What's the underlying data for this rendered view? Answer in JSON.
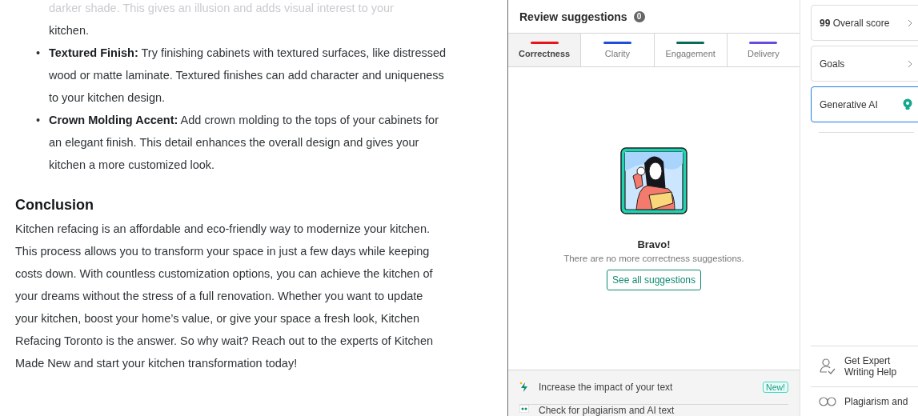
{
  "document": {
    "faded_text": "darker shade. This gives an illusion and adds visual interest to your",
    "bullets": [
      {
        "text": "kitchen."
      },
      {
        "marker": "•",
        "text": "**Textured Finish:** Try finishing cabinets with textured surfaces, like distressed wood or matte laminate. Textured finishes can add character and uniqueness to your kitchen design."
      },
      {
        "marker": "•",
        "text": "**Crown Molding Accent:** Add crown molding to the tops of your cabinets for an elegant finish. This detail enhances the overall design and gives your kitchen a more customized look."
      }
    ],
    "heading": "Conclusion",
    "paragraph": "Kitchen refacing is an affordable and eco-friendly way to modernize your kitchen. This process allows you to transform your space in just a few days while keeping costs down. With countless customization options, you can achieve the kitchen of your dreams without the stress of a full renovation. Whether you want to update your kitchen, boost your home’s value, or give your space a fresh look, Kitchen Refacing Toronto is the answer. So why wait? Reach out to the experts of Kitchen Made New and start your kitchen transformation today!"
  },
  "review": {
    "title": "Review suggestions",
    "count": "0",
    "tabs": [
      {
        "label": "Correctness",
        "color": "#e8141b",
        "selected": true
      },
      {
        "label": "Clarity",
        "color": "#1f4fd8",
        "selected": false
      },
      {
        "label": "Engagement",
        "color": "#0b6b57",
        "selected": false
      },
      {
        "label": "Delivery",
        "color": "#6a4be0",
        "selected": false
      }
    ],
    "empty": {
      "title": "Bravo!",
      "message": "There are no more correctness suggestions.",
      "button": "See all suggestions"
    },
    "footer": [
      {
        "kind": "impact",
        "label": "Increase the impact of your text",
        "badge": "New!"
      },
      {
        "kind": "plagiarism",
        "label": "Check for plagiarism and AI text"
      }
    ]
  },
  "sidebar": {
    "cards": [
      {
        "kind": "score",
        "score": "99",
        "label": "Overall score",
        "selected": false
      },
      {
        "kind": "link",
        "label": "Goals",
        "selected": false
      },
      {
        "kind": "ai",
        "label": "Generative AI",
        "selected": true
      }
    ],
    "tools": [
      {
        "kind": "expert",
        "label": "Get Expert Writing Help"
      },
      {
        "kind": "plagiarism",
        "label": "Plagiarism and"
      }
    ]
  }
}
